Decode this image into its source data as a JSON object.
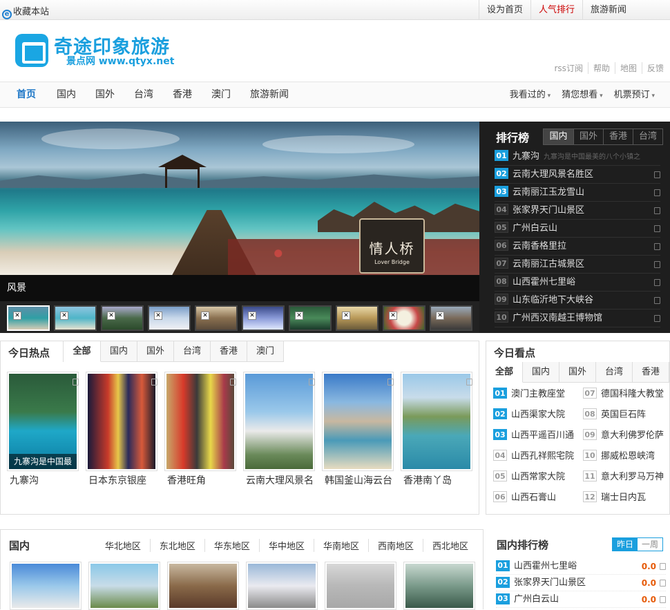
{
  "topbar": {
    "favorite": "收藏本站",
    "links": [
      "设为首页",
      "人气排行",
      "旅游新闻"
    ]
  },
  "header": {
    "title": "奇途印象旅游",
    "subtitle": "景点网 www.qtyx.net",
    "links": [
      "rss订阅",
      "帮助",
      "地图",
      "反馈"
    ]
  },
  "nav": {
    "items": [
      "首页",
      "国内",
      "国外",
      "台湾",
      "香港",
      "澳门",
      "旅游新闻"
    ],
    "right": [
      "我看过的",
      "猜您想看",
      "机票预订"
    ]
  },
  "banner": {
    "sign_cn": "情人桥",
    "sign_en": "Lover Bridge",
    "caption": "风景"
  },
  "ranking": {
    "title": "排行榜",
    "tabs": [
      "国内",
      "国外",
      "香港",
      "台湾"
    ],
    "items": [
      {
        "n": "01",
        "name": "九寨沟",
        "desc": "九寨沟是中国最美的八个小镇之"
      },
      {
        "n": "02",
        "name": "云南大理风景名胜区",
        "desc": ""
      },
      {
        "n": "03",
        "name": "云南丽江玉龙雪山",
        "desc": ""
      },
      {
        "n": "04",
        "name": "张家界天门山景区",
        "desc": ""
      },
      {
        "n": "05",
        "name": "广州白云山",
        "desc": ""
      },
      {
        "n": "06",
        "name": "云南香格里拉",
        "desc": ""
      },
      {
        "n": "07",
        "name": "云南丽江古城景区",
        "desc": ""
      },
      {
        "n": "08",
        "name": "山西霍州七里峪",
        "desc": ""
      },
      {
        "n": "09",
        "name": "山东临沂地下大峡谷",
        "desc": ""
      },
      {
        "n": "10",
        "name": "广州西汉南越王博物馆",
        "desc": ""
      }
    ]
  },
  "hot": {
    "title": "今日热点",
    "tabs": [
      "全部",
      "国内",
      "国外",
      "台湾",
      "香港",
      "澳门"
    ],
    "items": [
      {
        "label": "九寨沟",
        "overlay": "九寨沟是中国最"
      },
      {
        "label": "日本东京银座",
        "overlay": ""
      },
      {
        "label": "香港旺角",
        "overlay": ""
      },
      {
        "label": "云南大理风景名",
        "overlay": ""
      },
      {
        "label": "韩国釜山海云台",
        "overlay": ""
      },
      {
        "label": "香港南丫岛",
        "overlay": ""
      }
    ]
  },
  "watch": {
    "title": "今日看点",
    "tabs": [
      "全部",
      "国内",
      "国外",
      "台湾",
      "香港"
    ],
    "items": [
      {
        "n": "01",
        "name": "澳门主教座堂"
      },
      {
        "n": "07",
        "name": "德国科隆大教堂"
      },
      {
        "n": "02",
        "name": "山西渠家大院"
      },
      {
        "n": "08",
        "name": "英国巨石阵"
      },
      {
        "n": "03",
        "name": "山西平遥百川通"
      },
      {
        "n": "09",
        "name": "意大利佛罗伦萨"
      },
      {
        "n": "04",
        "name": "山西孔祥熙宅院"
      },
      {
        "n": "10",
        "name": "挪威松恩峡湾"
      },
      {
        "n": "05",
        "name": "山西常家大院"
      },
      {
        "n": "11",
        "name": "意大利罗马万神"
      },
      {
        "n": "06",
        "name": "山西石膏山"
      },
      {
        "n": "12",
        "name": "瑞士日内瓦"
      }
    ]
  },
  "domestic": {
    "title": "国内",
    "regions": [
      "华北地区",
      "东北地区",
      "华东地区",
      "华中地区",
      "华南地区",
      "西南地区",
      "西北地区"
    ]
  },
  "domestic_rank": {
    "title": "国内排行榜",
    "switch": [
      "昨日",
      "一周"
    ],
    "items": [
      {
        "n": "01",
        "name": "山西霍州七里峪",
        "score": "0.0"
      },
      {
        "n": "02",
        "name": "张家界天门山景区",
        "score": "0.0"
      },
      {
        "n": "03",
        "name": "广州白云山",
        "score": "0.0"
      }
    ]
  },
  "colors": {
    "accent": "#1a9fde",
    "hot": "#cc0000"
  }
}
